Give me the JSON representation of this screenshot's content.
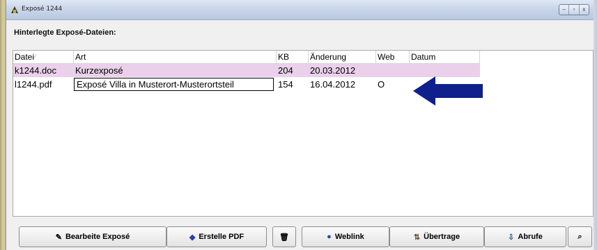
{
  "window": {
    "title": "Exposé 1244",
    "controls": [
      "–",
      "▫",
      "x"
    ]
  },
  "section_label": "Hinterlegte Exposé-Dateien:",
  "table": {
    "columns": [
      "Datei",
      "Art",
      "KB",
      "Änderung",
      "Web",
      "Datum"
    ],
    "rows": [
      {
        "datei": "k1244.doc",
        "art": "Kurzexposé",
        "kb": "204",
        "aenderung": "20.03.2012",
        "web": "",
        "datum": ""
      },
      {
        "datei": "l1244.pdf",
        "art": "Exposé Villa in Musterort-Musterortsteil",
        "kb": "154",
        "aenderung": "16.04.2012",
        "web": "O",
        "datum": ""
      }
    ]
  },
  "buttons": {
    "bearbeite": "Bearbeite Exposé",
    "erstelle_pdf": "Erstelle PDF",
    "trash": "",
    "weblink": "Weblink",
    "uebertrage": "Übertrage",
    "abrufe": "Abrufe",
    "search": ""
  },
  "icons": {
    "app": "app-icon",
    "bearbeite": "pencil-icon",
    "erstelle_pdf": "diamond-icon",
    "trash": "trash-icon",
    "weblink": "globe-icon",
    "uebertrage": "transfer-icon",
    "abrufe": "download-icon",
    "search": "magnifier-icon"
  },
  "colors": {
    "selected_row": "#ead0ea",
    "arrow": "#0f1f8c"
  }
}
